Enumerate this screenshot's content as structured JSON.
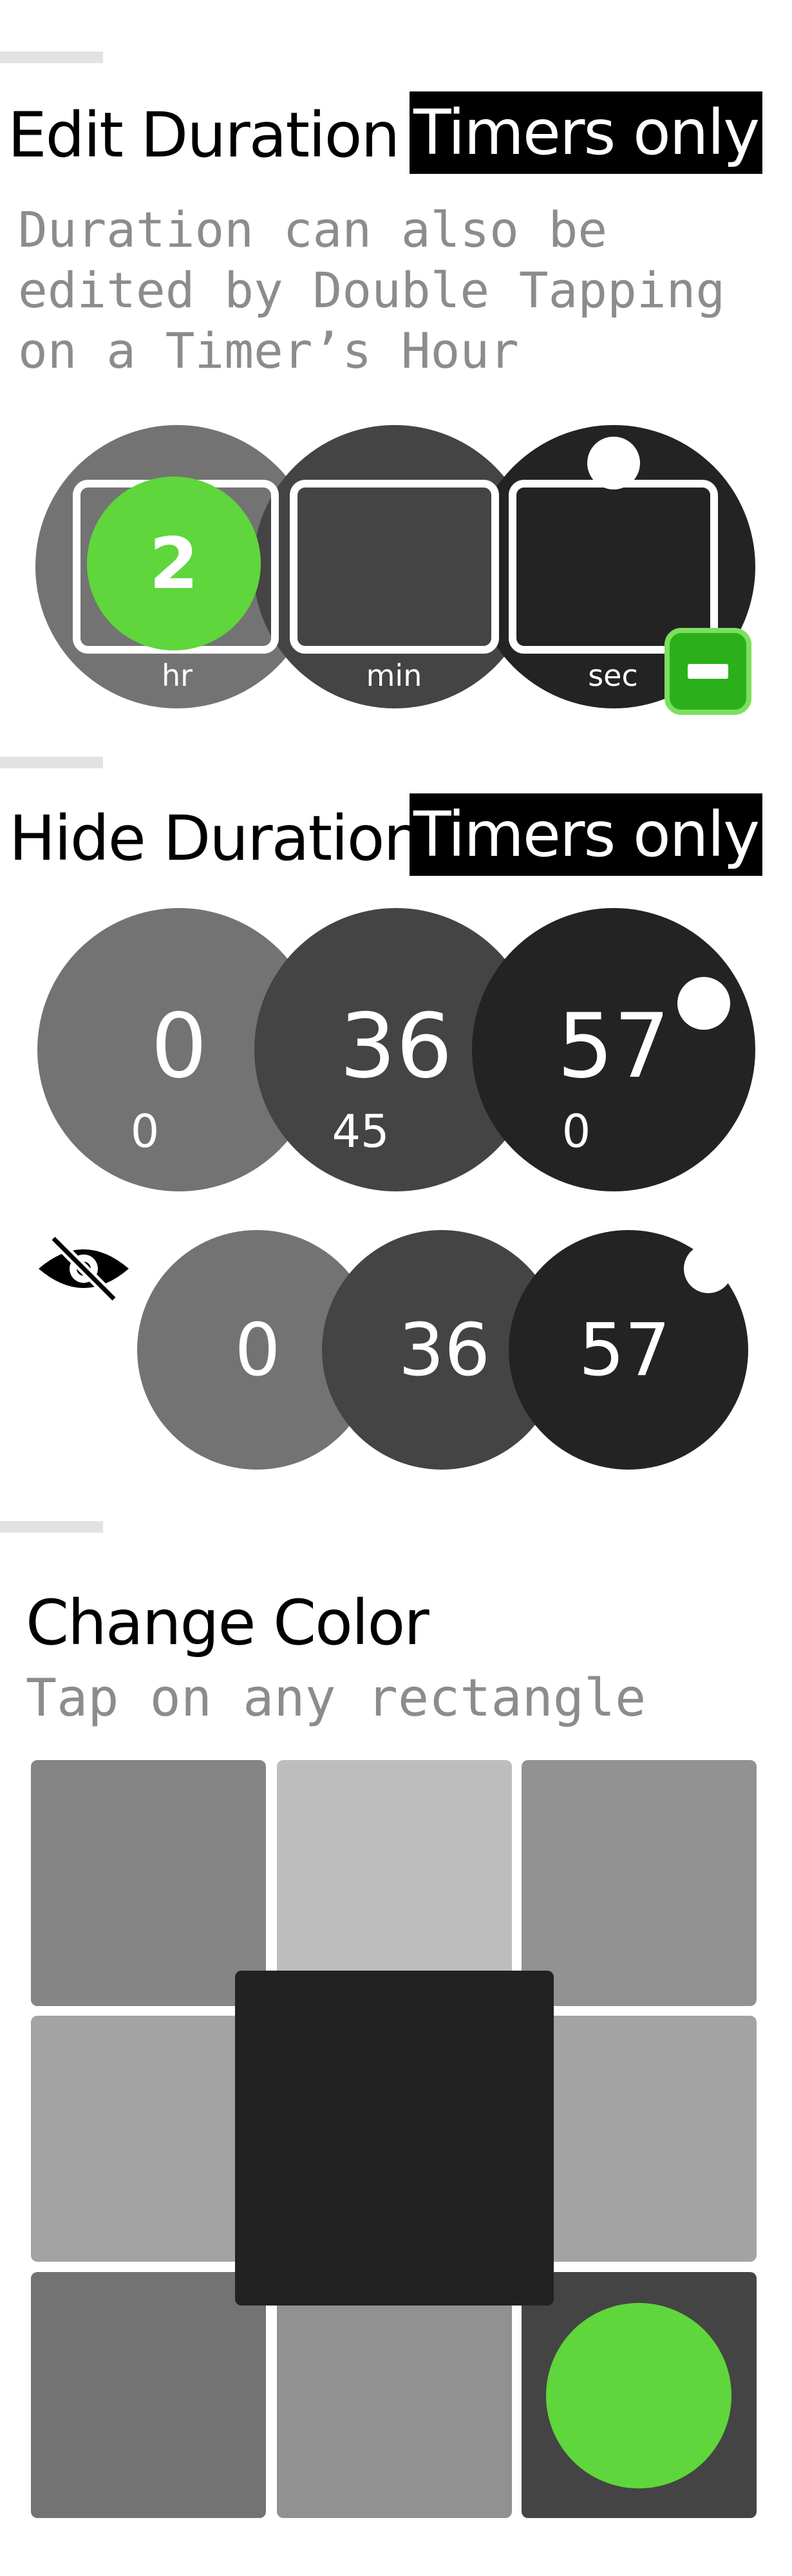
{
  "edit_section": {
    "title": "Edit Duration",
    "tag": "Timers only",
    "description_lines": [
      "Duration can also be",
      "edited by Double Tapping",
      "on a Timer’s Hour"
    ],
    "hour_value": "2",
    "units": [
      "hr",
      "min",
      "sec"
    ],
    "minus_symbol": "−",
    "accent_color": "#5fd63c"
  },
  "hide_section": {
    "title": "Hide Duration",
    "tag": "Timers only",
    "timer_full": {
      "values": [
        "0",
        "36",
        "57"
      ],
      "sub_values": [
        "0",
        "45",
        "0"
      ]
    },
    "timer_hidden": {
      "values": [
        "0",
        "36",
        "57"
      ]
    },
    "hidden_icon": "eye-slash-icon"
  },
  "color_section": {
    "title": "Change Color",
    "subtitle": "Tap on any rectangle",
    "selected_color": "#5fd63c"
  }
}
